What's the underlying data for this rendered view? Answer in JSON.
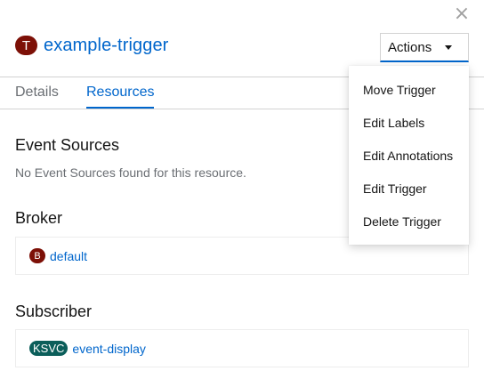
{
  "window": {
    "close_glyph": "×"
  },
  "header": {
    "badge": "T",
    "name": "example-trigger"
  },
  "actions": {
    "label": "Actions"
  },
  "tabs": [
    {
      "label": "Details",
      "active": false
    },
    {
      "label": "Resources",
      "active": true
    }
  ],
  "resources": {
    "event_sources": {
      "title": "Event Sources",
      "empty_text": "No Event Sources found for this resource."
    },
    "broker": {
      "title": "Broker",
      "badge": "B",
      "link": "default"
    },
    "subscriber": {
      "title": "Subscriber",
      "badge": "KSVC",
      "link": "event-display"
    }
  },
  "menu": {
    "items": [
      {
        "label": "Move Trigger"
      },
      {
        "label": "Edit Labels"
      },
      {
        "label": "Edit Annotations"
      },
      {
        "label": "Edit Trigger"
      },
      {
        "label": "Delete Trigger"
      }
    ]
  },
  "colors": {
    "link": "#0066cc",
    "trigger_badge": "#7d1007",
    "ksvc_badge": "#0b5e5a",
    "muted_text": "#6a6e73"
  }
}
